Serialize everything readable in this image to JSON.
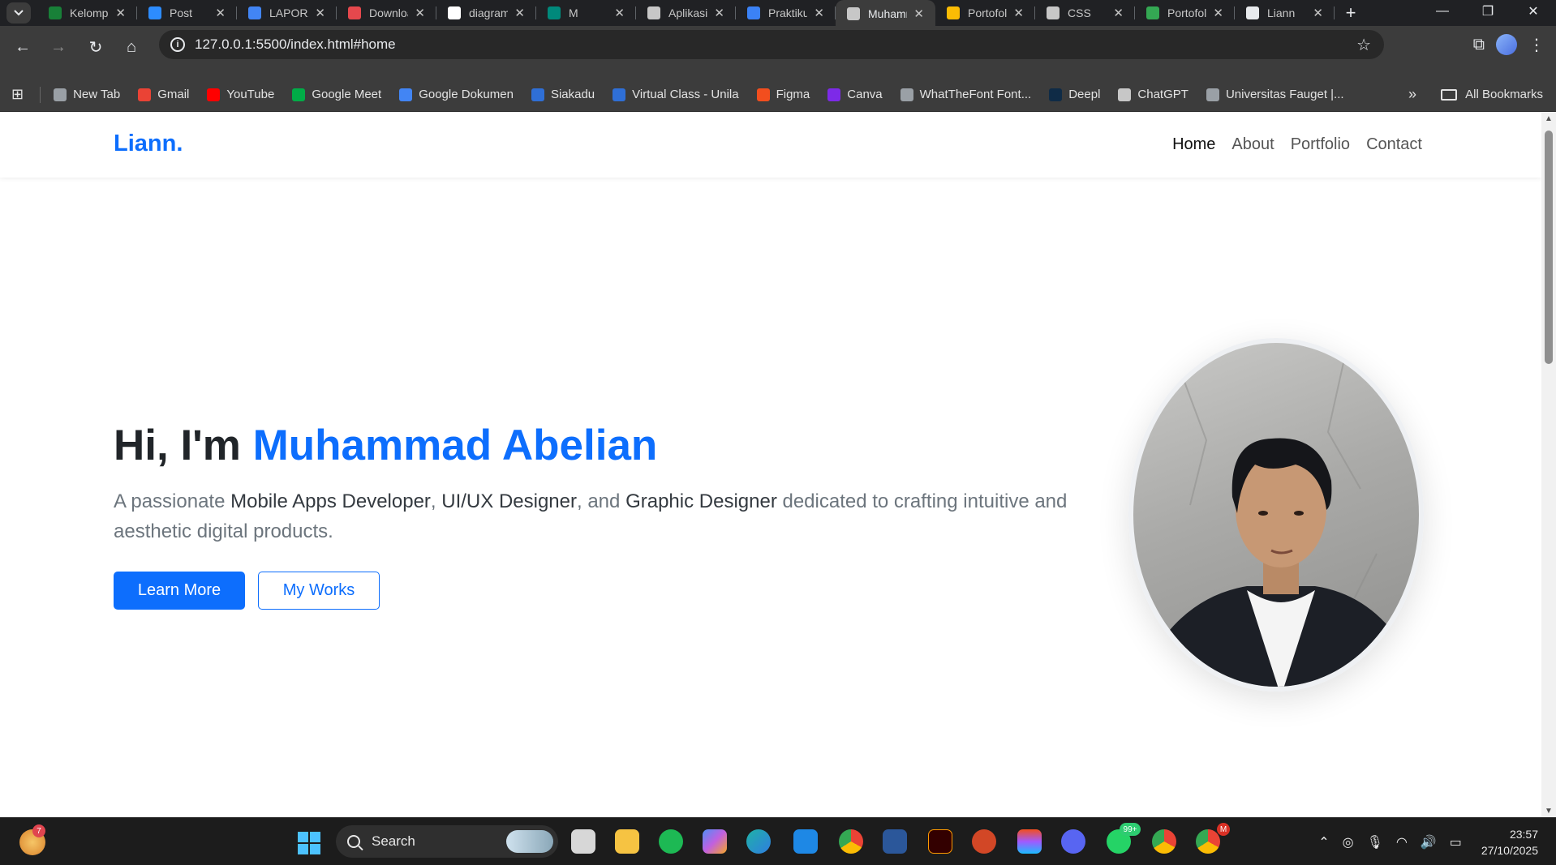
{
  "browser": {
    "tabs": [
      {
        "title": "Kelompok",
        "color": "#188038"
      },
      {
        "title": "Post",
        "color": "#2d8cff"
      },
      {
        "title": "LAPORAN",
        "color": "#4285f4"
      },
      {
        "title": "Download",
        "color": "#e5484d"
      },
      {
        "title": "diagram",
        "color": "#ffffff"
      },
      {
        "title": "M",
        "color": "#00897b"
      },
      {
        "title": "Aplikasi",
        "color": "#c7c7c7"
      },
      {
        "title": "Praktikum",
        "color": "#3b82f6"
      },
      {
        "title": "Muhammad",
        "color": "#c7c7c7"
      },
      {
        "title": "Portofolio",
        "color": "#fbbc04"
      },
      {
        "title": "CSS",
        "color": "#c7c7c7"
      },
      {
        "title": "Portofolio",
        "color": "#34a853"
      },
      {
        "title": "Liann",
        "color": "#e8eaed"
      }
    ],
    "active_tab_index": 8,
    "tab_close_glyph": "✕",
    "new_tab_glyph": "+",
    "url": "127.0.0.1:5500/index.html#home",
    "bookmarks": [
      {
        "label": "New Tab",
        "color": "#9aa0a6"
      },
      {
        "label": "Gmail",
        "color": "#ea4335"
      },
      {
        "label": "YouTube",
        "color": "#ff0000"
      },
      {
        "label": "Google Meet",
        "color": "#00ac47"
      },
      {
        "label": "Google Dokumen",
        "color": "#4285f4"
      },
      {
        "label": "Siakadu",
        "color": "#2f6fd6"
      },
      {
        "label": "Virtual Class - Unila",
        "color": "#2f6fd6"
      },
      {
        "label": "Figma",
        "color": "#f24e1e"
      },
      {
        "label": "Canva",
        "color": "#7d2ae8"
      },
      {
        "label": "WhatTheFont Font...",
        "color": "#9aa0a6"
      },
      {
        "label": "Deepl",
        "color": "#0f2b46"
      },
      {
        "label": "ChatGPT",
        "color": "#c7c7c7"
      },
      {
        "label": "Universitas Fauget |...",
        "color": "#9aa0a6"
      }
    ],
    "all_bookmarks_label": "All Bookmarks"
  },
  "site": {
    "brand": "Liann.",
    "nav": [
      "Home",
      "About",
      "Portfolio",
      "Contact"
    ],
    "active_nav": "Home",
    "hero": {
      "greeting": "Hi, I'm",
      "name": "Muhammad Abelian",
      "desc_1": "A passionate",
      "role_1": "Mobile Apps Developer",
      "desc_2": ",",
      "role_2": "UI/UX Designer",
      "desc_3": ", and",
      "role_3": "Graphic Designer",
      "desc_4": "dedicated to crafting intuitive and aesthetic digital products.",
      "primary_button": "Learn More",
      "secondary_button": "My Works"
    },
    "accent_color": "#0d6efd"
  },
  "taskbar": {
    "widget_badge": "7",
    "search_placeholder": "Search",
    "whatsapp_badge": "99+",
    "chrome_badge": "M",
    "time": "23:57",
    "date": "27/10/2025"
  }
}
